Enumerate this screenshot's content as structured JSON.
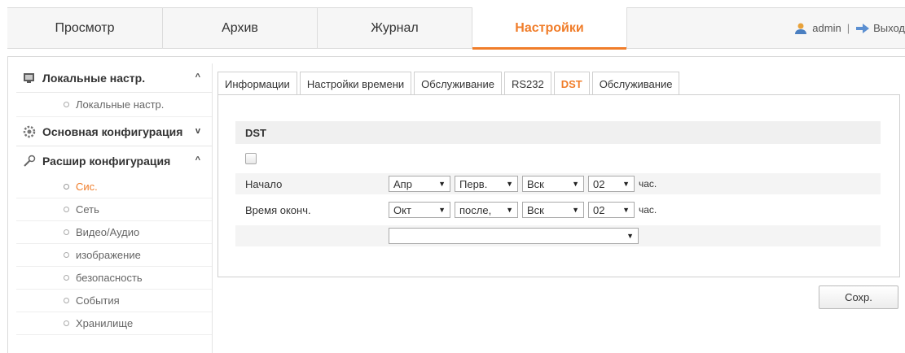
{
  "topnav": {
    "items": [
      {
        "label": "Просмотр",
        "active": false
      },
      {
        "label": "Архив",
        "active": false
      },
      {
        "label": "Журнал",
        "active": false
      },
      {
        "label": "Настройки",
        "active": true
      }
    ],
    "user": "admin",
    "separator": "|",
    "logout": "Выход"
  },
  "sidebar": {
    "groups": [
      {
        "label": "Локальные настр.",
        "icon": "monitor-icon",
        "chevron": "^",
        "items": [
          {
            "label": "Локальные настр.",
            "active": false
          }
        ]
      },
      {
        "label": "Основная конфигурация",
        "icon": "gear-icon",
        "chevron": "v",
        "items": []
      },
      {
        "label": "Расшир конфигурация",
        "icon": "wrench-icon",
        "chevron": "^",
        "items": [
          {
            "label": "Сис.",
            "active": true
          },
          {
            "label": "Сеть",
            "active": false
          },
          {
            "label": "Видео/Аудио",
            "active": false
          },
          {
            "label": "изображение",
            "active": false
          },
          {
            "label": "безопасность",
            "active": false
          },
          {
            "label": "События",
            "active": false
          },
          {
            "label": "Хранилище",
            "active": false
          }
        ]
      }
    ]
  },
  "tabs": [
    {
      "label": "Информации",
      "active": false
    },
    {
      "label": "Настройки времени",
      "active": false
    },
    {
      "label": "Обслуживание",
      "active": false
    },
    {
      "label": "RS232",
      "active": false
    },
    {
      "label": "DST",
      "active": true
    },
    {
      "label": "Обслуживание",
      "active": false
    }
  ],
  "dst": {
    "title": "DST",
    "enabled": false,
    "start": {
      "label": "Начало",
      "month": "Апр",
      "week": "Перв.",
      "day": "Вск",
      "hour": "02",
      "unit": "час."
    },
    "end": {
      "label": "Время оконч.",
      "month": "Окт",
      "week": "после,",
      "day": "Вск",
      "hour": "02",
      "unit": "час."
    },
    "bias": ""
  },
  "save_label": "Сохр.",
  "colors": {
    "accent": "#f07d2a",
    "text": "#333333",
    "border": "#cfcfcf"
  }
}
